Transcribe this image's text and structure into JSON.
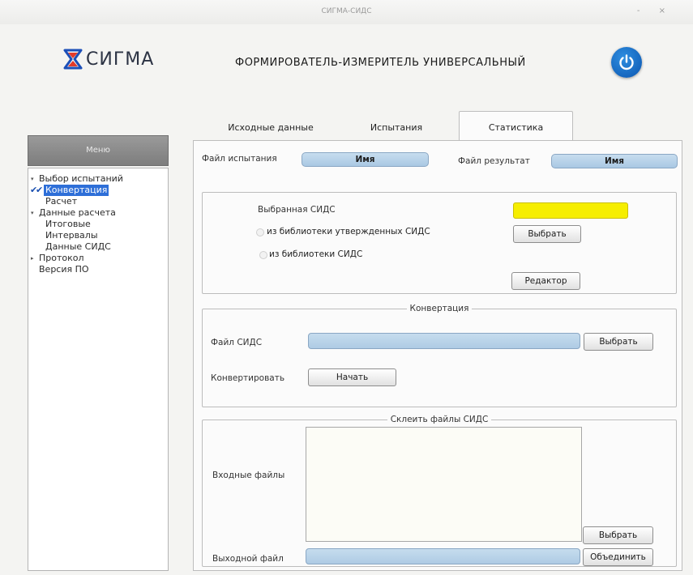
{
  "window": {
    "title": "СИГМА-СИДС"
  },
  "header": {
    "logo_text": "СИГМА",
    "app_title": "ФОРМИРОВАТЕЛЬ-ИЗМЕРИТЕЛЬ УНИВЕРСАЛЬНЫЙ",
    "power_icon": "power-icon",
    "brand_color": "#0a55b0"
  },
  "tabs": [
    {
      "label": "Исходные данные",
      "active": false
    },
    {
      "label": "Испытания",
      "active": false
    },
    {
      "label": "Статистика",
      "active": true
    }
  ],
  "sidebar": {
    "title": "Меню",
    "items": [
      {
        "label": "Выбор испытаний",
        "level": 0,
        "expanded": true
      },
      {
        "label": "Конвертация",
        "level": 1,
        "checked": true,
        "selected": true
      },
      {
        "label": "Расчет",
        "level": 1
      },
      {
        "label": "Данные расчета",
        "level": 0,
        "expanded": true
      },
      {
        "label": "Итоговые",
        "level": 1
      },
      {
        "label": "Интервалы",
        "level": 1
      },
      {
        "label": "Данные СИДС",
        "level": 1
      },
      {
        "label": "Протокол",
        "level": 0,
        "expanded": false
      },
      {
        "label": "Версия ПО",
        "level": 0
      }
    ]
  },
  "files": {
    "test_file_label": "Файл испытания",
    "test_file_value": "Имя",
    "result_file_label": "Файл результат",
    "result_file_value": "Имя"
  },
  "sids": {
    "selected_label": "Выбранная СИДС",
    "selected_color": "#f6ee00",
    "option_approved": "из библиотеки утвержденных СИДС",
    "option_library": "из библиотеки СИДС",
    "choose_button": "Выбрать",
    "editor_button": "Редактор"
  },
  "conversion": {
    "title": "Конвертация",
    "file_label": "Файл СИДС",
    "choose_button": "Выбрать",
    "convert_label": "Конвертировать",
    "start_button": "Начать"
  },
  "merge": {
    "title": "Склеить файлы СИДС",
    "input_label": "Входные файлы",
    "choose_button": "Выбрать",
    "output_label": "Выходной файл",
    "merge_button": "Объединить"
  }
}
